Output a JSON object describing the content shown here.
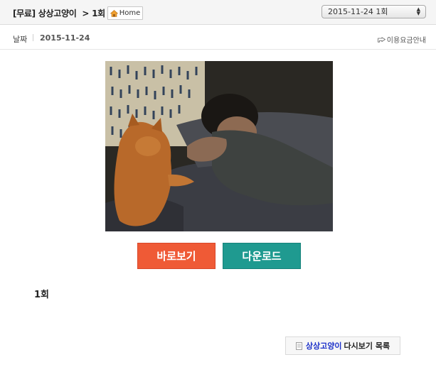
{
  "header": {
    "badge": "[무료]",
    "show_title": "상상고양이",
    "separator": ">",
    "episode": "1회",
    "home_label": "Home",
    "episode_select_value": "2015-11-24 1회"
  },
  "info": {
    "date_label": "날짜",
    "date_value": "2015-11-24",
    "fee_link": "이용요금안내"
  },
  "actions": {
    "watch_label": "바로보기",
    "download_label": "다운로드"
  },
  "content": {
    "episode_title": "1회"
  },
  "footer": {
    "show_name": "상상고양이",
    "list_suffix": "다시보기 목록"
  },
  "colors": {
    "watch": "#ef5a36",
    "download": "#1f9a90",
    "link": "#1a2fc9"
  },
  "icons": {
    "home": "home-icon",
    "hand": "pointing-hand-icon",
    "document": "document-icon",
    "select_arrows": "updown-arrow-icon"
  }
}
